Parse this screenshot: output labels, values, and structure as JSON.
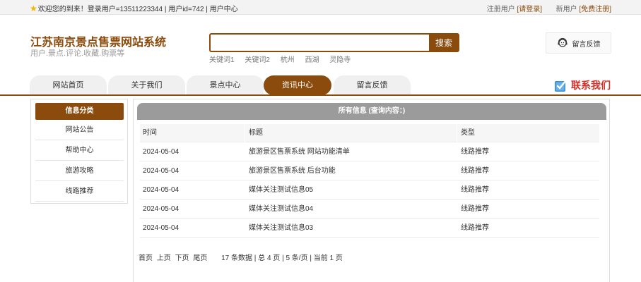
{
  "topbar": {
    "welcome": "欢迎您的到来！登录用户=13511223344 | 用户id=742 | 用户中心",
    "register_prefix": "注册用户",
    "login_link": "[请登录]",
    "new_user_prefix": "新用户",
    "free_register_link": "[免费注册]"
  },
  "header": {
    "title": "江苏南京景点售票网站系统",
    "subtitle": "用户.景点.评论.收藏.购票等",
    "search_placeholder": "",
    "search_button": "搜索",
    "keywords": [
      "关键词1",
      "关键词2",
      "杭州",
      "西湖",
      "灵隐寺"
    ],
    "feedback_button": "留言反馈"
  },
  "nav": {
    "items": [
      "网站首页",
      "关于我们",
      "景点中心",
      "资讯中心",
      "留言反馈"
    ],
    "active_index": 3,
    "contact": "联系我们"
  },
  "sidebar": {
    "title": "信息分类",
    "items": [
      "网站公告",
      "帮助中心",
      "旅游攻略",
      "线路推荐"
    ]
  },
  "main": {
    "title": "所有信息 (查询内容：)",
    "columns": [
      "时间",
      "标题",
      "类型"
    ],
    "rows": [
      [
        "2024-05-04",
        "旅游景区售票系统 网站功能清单",
        "线路推荐"
      ],
      [
        "2024-05-04",
        "旅游景区售票系统 后台功能",
        "线路推荐"
      ],
      [
        "2024-05-04",
        "媒体关注测试信息05",
        "线路推荐"
      ],
      [
        "2024-05-04",
        "媒体关注测试信息04",
        "线路推荐"
      ],
      [
        "2024-05-04",
        "媒体关注测试信息03",
        "线路推荐"
      ]
    ],
    "pager": {
      "first": "首页",
      "prev": "上页",
      "next": "下页",
      "last": "尾页",
      "info": "17 条数据 | 总 4 页 | 5 条/页 | 当前 1 页"
    }
  },
  "colors": {
    "brand": "#8a4b0c",
    "contact_red": "#d4302a",
    "panel_head": "#9b9b9b"
  }
}
